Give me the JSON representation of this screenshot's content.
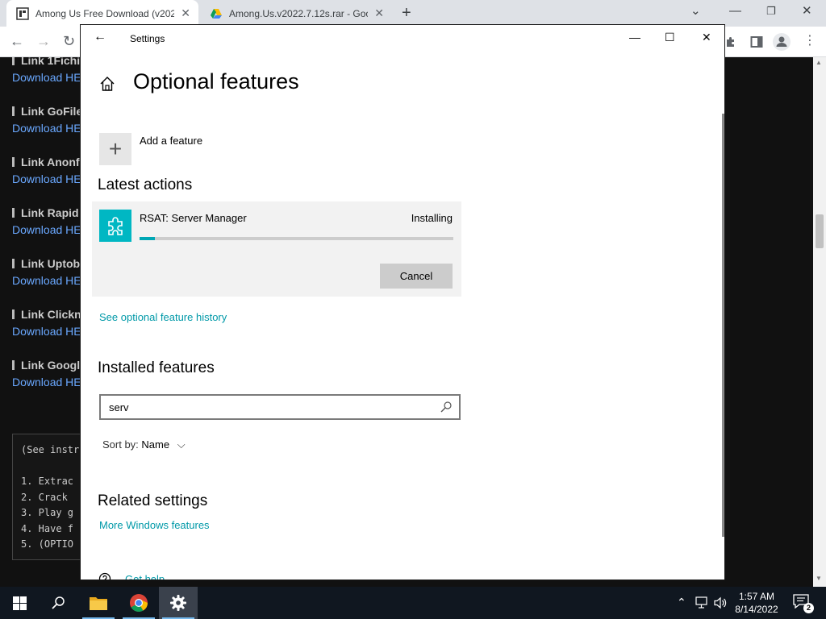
{
  "browser": {
    "tabs": [
      {
        "title": "Among Us Free Download (v202",
        "active": true
      },
      {
        "title": "Among.Us.v2022.7.12s.rar - Goog",
        "active": false
      }
    ],
    "icons": {
      "new_tab": "plus-icon",
      "minimize": "minimize-icon",
      "restore": "restore-icon",
      "close": "close-icon",
      "back": "back-arrow-icon",
      "forward": "forward-arrow-icon",
      "reload": "reload-icon",
      "extensions": "puzzle-icon",
      "sidebar": "side-panel-icon",
      "profile": "profile-icon",
      "menu": "kebab-menu-icon"
    }
  },
  "page": {
    "links": [
      {
        "heading": "Link 1Fichi",
        "download": "Download HE"
      },
      {
        "heading": "Link GoFile",
        "download": "Download HE"
      },
      {
        "heading": "Link Anonf",
        "download": "Download HE"
      },
      {
        "heading": "Link Rapid",
        "download": "Download HE"
      },
      {
        "heading": "Link Uptob",
        "download": "Download HE"
      },
      {
        "heading": "Link Clickn",
        "download": "Download HE"
      },
      {
        "heading": "Link Googl",
        "download": "Download HE"
      }
    ],
    "instructions": [
      "(See instr",
      "1.  Extrac",
      "2.  Crack",
      "3.  Play g",
      "4.  Have f",
      "5.  (OPTIO"
    ]
  },
  "settings": {
    "window_title": "Settings",
    "heading": "Optional features",
    "add_feature": "Add a feature",
    "latest_actions_title": "Latest actions",
    "action": {
      "name": "RSAT: Server Manager",
      "status": "Installing",
      "progress_fraction": 0.05,
      "cancel_label": "Cancel",
      "icon": "puzzle-piece-icon"
    },
    "history_link": "See optional feature history",
    "installed_title": "Installed features",
    "search_value": "serv",
    "sort_label": "Sort by:",
    "sort_value": "Name",
    "related_title": "Related settings",
    "more_windows_link": "More Windows features",
    "get_help": "Get help"
  },
  "taskbar": {
    "items": [
      "windows-start-icon",
      "search-icon",
      "file-explorer-icon",
      "chrome-icon",
      "settings-gear-icon"
    ],
    "time": "1:57 AM",
    "date": "8/14/2022",
    "notification_count": "2"
  },
  "colors": {
    "accent": "#00b7c3",
    "link": "#0099a8",
    "taskbar": "#101720",
    "page_bg": "#111111"
  }
}
